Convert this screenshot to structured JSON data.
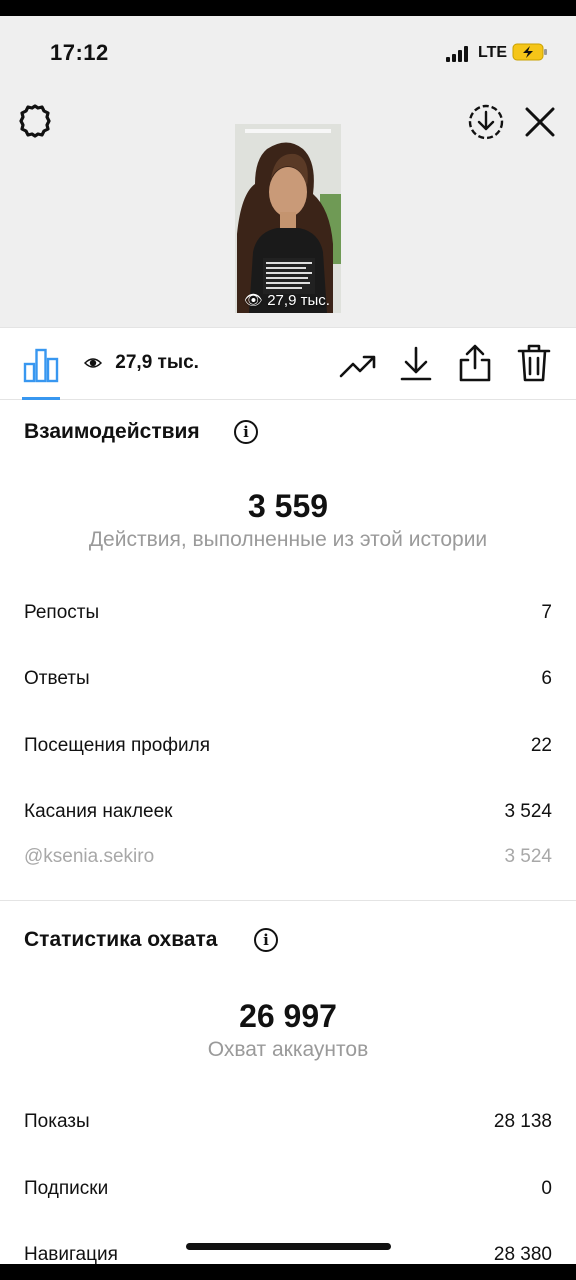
{
  "status_bar": {
    "time": "17:12",
    "network": "LTE"
  },
  "story_preview": {
    "views_caption": "27,9 тыс."
  },
  "toolbar": {
    "views_count": "27,9 тыс."
  },
  "interactions": {
    "title": "Взаимодействия",
    "total": "3 559",
    "total_label": "Действия, выполненные из этой истории",
    "rows": [
      {
        "label": "Репосты",
        "value": "7"
      },
      {
        "label": "Ответы",
        "value": "6"
      },
      {
        "label": "Посещения профиля",
        "value": "22"
      },
      {
        "label": "Касания наклеек",
        "value": "3 524"
      }
    ],
    "sticker_detail": {
      "label": "@ksenia.sekiro",
      "value": "3 524"
    }
  },
  "reach": {
    "title": "Статистика охвата",
    "total": "26 997",
    "total_label": "Охват аккаунтов",
    "rows": [
      {
        "label": "Показы",
        "value": "28 138"
      },
      {
        "label": "Подписки",
        "value": "0"
      },
      {
        "label": "Навигация",
        "value": "28 380"
      }
    ]
  },
  "icons": [
    "gear-icon",
    "download-circle-icon",
    "close-icon",
    "bar-chart-icon",
    "eye-icon",
    "trending-icon",
    "download-icon",
    "share-icon",
    "trash-icon",
    "info-icon"
  ],
  "colors": {
    "accent": "#3897f0",
    "muted_text": "#9a9a9a",
    "header_bg": "#efefef"
  }
}
